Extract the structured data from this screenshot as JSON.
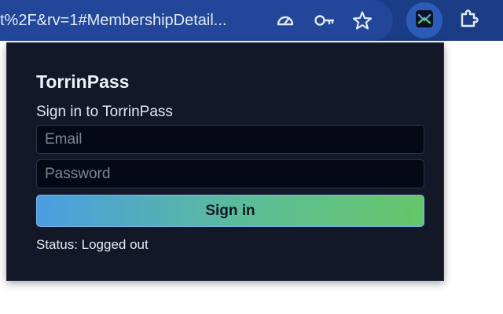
{
  "browser": {
    "url_text": "t%2F&rv=1#MembershipDetail...",
    "icons": [
      "speedometer-icon",
      "key-icon",
      "star-icon",
      "torrinpass-extension-icon",
      "puzzle-extension-icon"
    ],
    "colors": {
      "toolbar": "#1b3d86",
      "omnibox": "#22479a"
    }
  },
  "popup": {
    "brand": "TorrinPass",
    "subtitle": "Sign in to TorrinPass",
    "email": {
      "value": "",
      "placeholder": "Email"
    },
    "password": {
      "value": "",
      "placeholder": "Password"
    },
    "signin_label": "Sign in",
    "status_text": "Status: Logged out",
    "colors": {
      "background": "#121828",
      "field_background": "#050915",
      "button_gradient_start": "#4a9de2",
      "button_gradient_end": "#66c66a"
    }
  }
}
